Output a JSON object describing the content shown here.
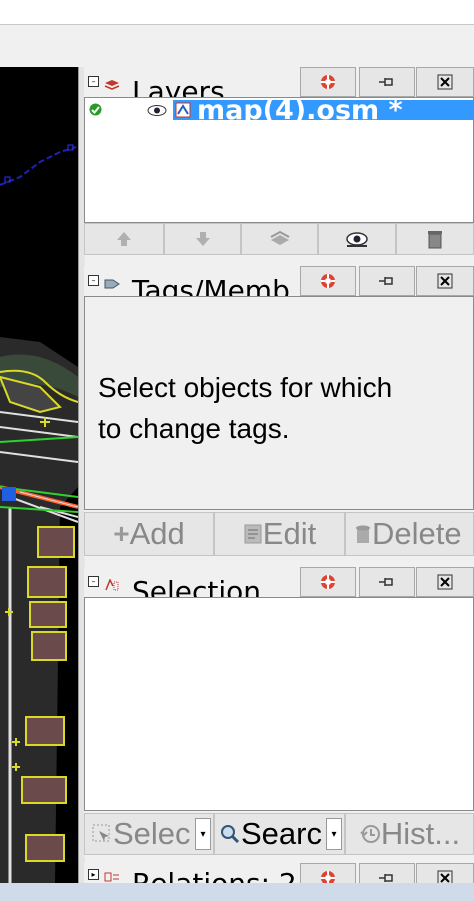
{
  "layers_panel": {
    "title": "Layers",
    "layer_name": "map(4).osm *",
    "toolbar_icons": [
      "arrow-up-icon",
      "arrow-down-icon",
      "merge-layers-icon",
      "eye-icon",
      "trash-icon"
    ]
  },
  "tags_panel": {
    "title": "Tags/Memb",
    "message_line1": "Select objects for which",
    "message_line2": "to change tags.",
    "buttons": {
      "add": "Add",
      "edit": "Edit",
      "delete": "Delete"
    }
  },
  "selection_panel": {
    "title": "Selection",
    "buttons": {
      "select": "Selec",
      "search": "Searc",
      "history": "Hist..."
    }
  },
  "relations_panel": {
    "title": "Relations: 2"
  },
  "colors": {
    "selected_row": "#3399ff",
    "map_background": "#000000"
  }
}
